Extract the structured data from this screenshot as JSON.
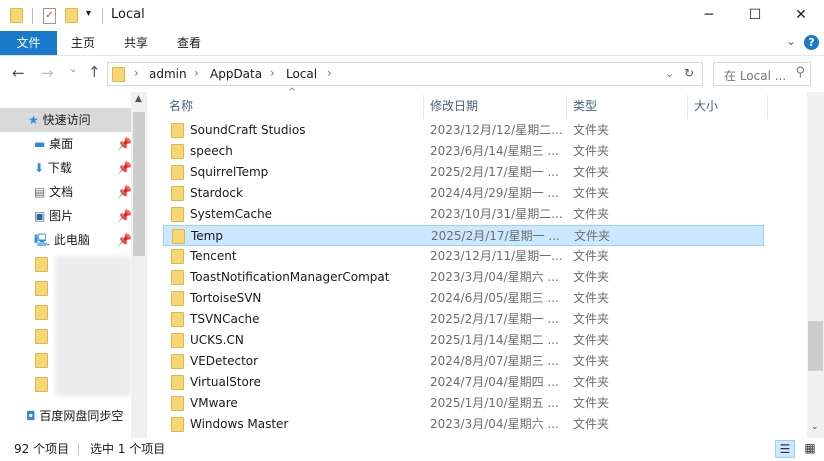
{
  "title": "Local",
  "window_controls": {
    "minimize": "─",
    "maximize": "☐",
    "close": "✕"
  },
  "ribbon": {
    "tabs": [
      "文件",
      "主页",
      "共享",
      "查看"
    ],
    "help": "?",
    "expand": "⌄"
  },
  "address": {
    "back": "←",
    "forward": "→",
    "recent": "⌄",
    "up": "↑",
    "crumbs": [
      "admin",
      "AppData",
      "Local"
    ],
    "refresh": "↻",
    "search_placeholder": "在 Local ...",
    "sep": "›"
  },
  "nav": {
    "items": [
      {
        "label": "快速访问",
        "icon": "star-icon"
      },
      {
        "label": "桌面",
        "icon": "desktop-icon",
        "pinned": true
      },
      {
        "label": "下载",
        "icon": "download-icon",
        "pinned": true
      },
      {
        "label": "文档",
        "icon": "document-icon",
        "pinned": true
      },
      {
        "label": "图片",
        "icon": "pictures-icon",
        "pinned": true
      },
      {
        "label": "此电脑",
        "icon": "computer-icon",
        "pinned": true
      }
    ],
    "cloud": "百度网盘同步空"
  },
  "columns": {
    "name": "名称",
    "date": "修改日期",
    "type": "类型",
    "size": "大小"
  },
  "files": [
    {
      "name": "SoundCraft Studios",
      "date": "2023/12月/12/星期二...",
      "type": "文件夹"
    },
    {
      "name": "speech",
      "date": "2023/6月/14/星期三 ...",
      "type": "文件夹"
    },
    {
      "name": "SquirrelTemp",
      "date": "2025/2月/17/星期一 ...",
      "type": "文件夹"
    },
    {
      "name": "Stardock",
      "date": "2024/4月/29/星期一 ...",
      "type": "文件夹"
    },
    {
      "name": "SystemCache",
      "date": "2023/10月/31/星期二...",
      "type": "文件夹"
    },
    {
      "name": "Temp",
      "date": "2025/2月/17/星期一 ...",
      "type": "文件夹",
      "selected": true
    },
    {
      "name": "Tencent",
      "date": "2023/12月/11/星期一...",
      "type": "文件夹"
    },
    {
      "name": "ToastNotificationManagerCompat",
      "date": "2023/3月/04/星期六 ...",
      "type": "文件夹"
    },
    {
      "name": "TortoiseSVN",
      "date": "2024/6月/05/星期三 ...",
      "type": "文件夹"
    },
    {
      "name": "TSVNCache",
      "date": "2025/2月/17/星期一 ...",
      "type": "文件夹"
    },
    {
      "name": "UCKS.CN",
      "date": "2025/1月/14/星期二 ...",
      "type": "文件夹"
    },
    {
      "name": "VEDetector",
      "date": "2024/8月/07/星期三 ...",
      "type": "文件夹"
    },
    {
      "name": "VirtualStore",
      "date": "2024/7月/04/星期四 ...",
      "type": "文件夹"
    },
    {
      "name": "VMware",
      "date": "2025/1月/10/星期五 ...",
      "type": "文件夹"
    },
    {
      "name": "Windows Master",
      "date": "2023/3月/04/星期六 ...",
      "type": "文件夹"
    }
  ],
  "status": {
    "count": "92 个项目",
    "selected": "选中 1 个项目"
  },
  "colors": {
    "accent": "#1979ca",
    "selection": "#cce8ff",
    "folder": "#f7d774"
  }
}
